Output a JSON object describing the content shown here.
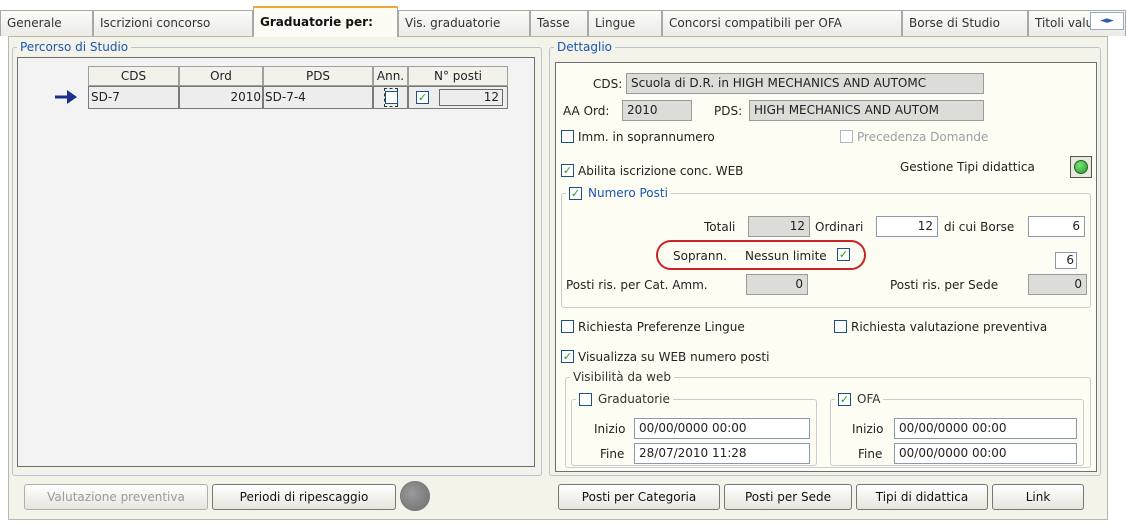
{
  "tabs": [
    {
      "label": "Generale",
      "active": false
    },
    {
      "label": "Iscrizioni concorso",
      "active": false
    },
    {
      "label": "Graduatorie per:",
      "active": true
    },
    {
      "label": "Vis. graduatorie",
      "active": false
    },
    {
      "label": "Tasse",
      "active": false
    },
    {
      "label": "Lingue",
      "active": false
    },
    {
      "label": "Concorsi compatibili per OFA",
      "active": false
    },
    {
      "label": "Borse di Studio",
      "active": false
    },
    {
      "label": "Titoli valuta",
      "active": false
    }
  ],
  "tab_scroll": {
    "left": "◄",
    "right": "►"
  },
  "percorso": {
    "title": "Percorso di Studio",
    "columns": [
      "CDS",
      "Ord",
      "PDS",
      "Ann.",
      "N° posti"
    ],
    "rows": [
      {
        "cds": "SD-7",
        "ord": "2010",
        "pds": "SD-7-4",
        "ann": false,
        "checked": true,
        "posti": "12"
      }
    ],
    "row_indicator_icon": "arrow-right-icon"
  },
  "left_buttons": {
    "valutazione": "Valutazione preventiva",
    "periodi": "Periodi di ripescaggio"
  },
  "dettaglio": {
    "title": "Dettaglio",
    "cds_label": "CDS:",
    "cds_value": "Scuola di D.R. in HIGH MECHANICS AND AUTOMC",
    "aa_label": "AA Ord:",
    "aa_value": "2010",
    "pds_label": "PDS:",
    "pds_value": "HIGH MECHANICS AND AUTOM",
    "imm_label": "Imm. in soprannumero",
    "imm_checked": false,
    "precedenza_label": "Precedenza Domande",
    "precedenza_checked": false,
    "abilita_label": "Abilita iscrizione conc. WEB",
    "abilita_checked": true,
    "gestione_label": "Gestione Tipi didattica",
    "numero_posti": {
      "title": "Numero Posti",
      "checked": true,
      "totali_label": "Totali",
      "totali_value": "12",
      "ordinari_label": "Ordinari",
      "ordinari_value": "12",
      "borse_label": "di cui Borse",
      "borse_value": "6",
      "soprann_label": "Soprann.",
      "nessun_label": "Nessun limite",
      "nessun_checked": true,
      "extra_value": "6",
      "cat_label": "Posti ris. per Cat. Amm.",
      "cat_value": "0",
      "sede_label": "Posti ris. per Sede",
      "sede_value": "0"
    },
    "pref_lingue_label": "Richiesta Preferenze Lingue",
    "pref_lingue_checked": false,
    "val_prev_label": "Richiesta valutazione preventiva",
    "val_prev_checked": false,
    "visualizza_label": "Visualizza su WEB numero posti",
    "visualizza_checked": true,
    "visibilita": {
      "title": "Visibilità da web",
      "graduatorie": {
        "title": "Graduatorie",
        "checked": false,
        "inizio_label": "Inizio",
        "inizio_value": "00/00/0000 00:00",
        "fine_label": "Fine",
        "fine_value": "28/07/2010 11:28"
      },
      "ofa": {
        "title": "OFA",
        "checked": true,
        "inizio_label": "Inizio",
        "inizio_value": "00/00/0000 00:00",
        "fine_label": "Fine",
        "fine_value": "00/00/0000 00:00"
      }
    }
  },
  "bottom_buttons": {
    "categoria": "Posti per Categoria",
    "sede": "Posti per Sede",
    "tipi": "Tipi di didattica",
    "link": "Link"
  },
  "check_glyph": "✓",
  "colors": {
    "accent": "#1a56b0",
    "highlight": "#c8242a",
    "check": "#21a121",
    "active_tab": "#f0a830"
  }
}
